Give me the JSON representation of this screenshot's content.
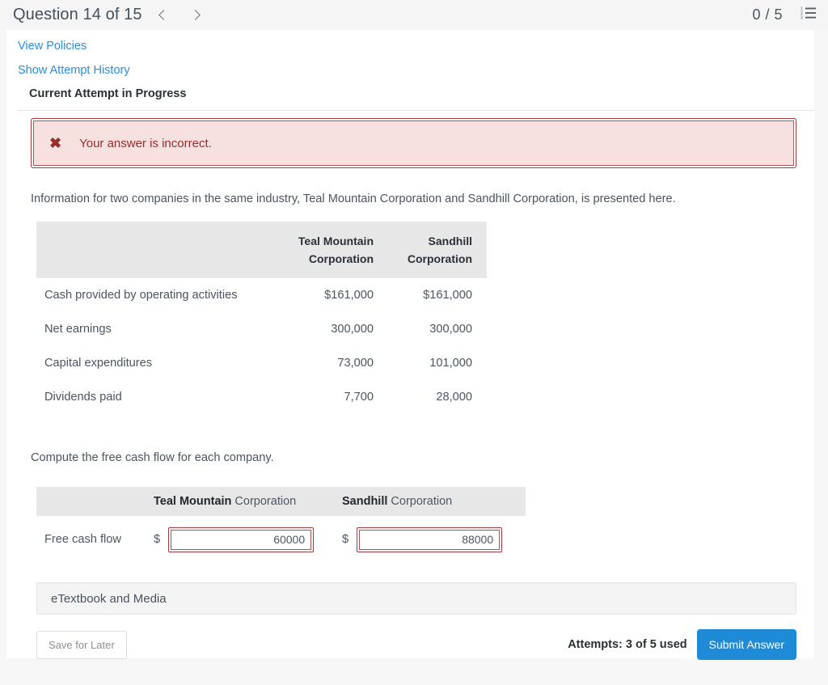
{
  "header": {
    "question_title": "Question 14 of 15",
    "prev_icon": "chevron-left-icon",
    "next_icon": "chevron-right-icon",
    "score": "0 / 5",
    "list_icon": "ordered-list-icon"
  },
  "links": {
    "view_policies": "View Policies",
    "show_attempt_history": "Show Attempt History",
    "current_attempt": "Current Attempt in Progress"
  },
  "alert": {
    "icon": "error-x-icon",
    "message": "Your answer is incorrect.",
    "background": "#f6e0e0",
    "border_color": "#a83a3a",
    "text_color": "#9e2a2a"
  },
  "body": {
    "intro": "Information for two companies in the same industry, Teal Mountain Corporation and Sandhill Corporation, is presented here.",
    "instruction": "Compute the free cash flow for each company."
  },
  "data_table": {
    "headers": [
      {
        "line1": "",
        "line2": ""
      },
      {
        "line1": "Teal Mountain",
        "line2": "Corporation"
      },
      {
        "line1": "Sandhill",
        "line2": "Corporation"
      }
    ],
    "rows": [
      {
        "label": "Cash provided by operating activities",
        "teal": "$161,000",
        "sandhill": "$161,000"
      },
      {
        "label": "Net earnings",
        "teal": "300,000",
        "sandhill": "300,000"
      },
      {
        "label": "Capital expenditures",
        "teal": "73,000",
        "sandhill": "101,000"
      },
      {
        "label": "Dividends paid",
        "teal": "7,700",
        "sandhill": "28,000"
      }
    ]
  },
  "answer_table": {
    "col1_bold": "Teal Mountain",
    "col1_rest": " Corporation",
    "col2_bold": "Sandhill",
    "col2_rest": " Corporation",
    "row_label": "Free cash flow",
    "currency": "$",
    "teal_value": "60000",
    "sandhill_value": "88000"
  },
  "etextbook": {
    "label": "eTextbook and Media"
  },
  "footer": {
    "save_label": "Save for Later",
    "attempts": "Attempts: 3 of 5 used",
    "submit_label": "Submit Answer",
    "submit_color": "#1f8ad6"
  }
}
